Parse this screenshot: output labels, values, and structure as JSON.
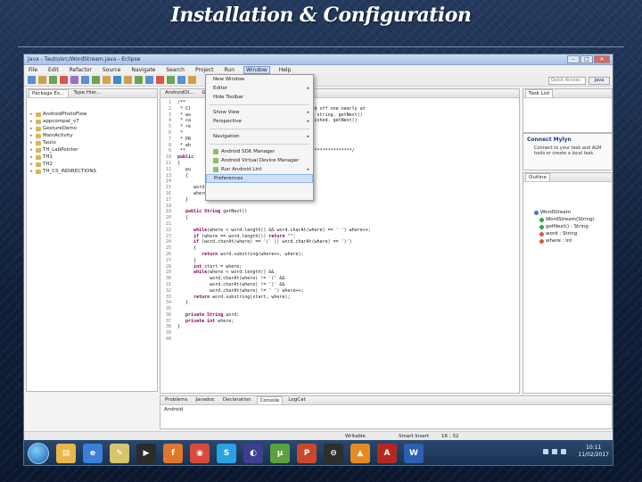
{
  "slide": {
    "title": "Installation & Configuration"
  },
  "window": {
    "title": "Java - Tauto/src/WordStream.java - Eclipse",
    "btn_min": "–",
    "btn_max": "□",
    "btn_close": "✕"
  },
  "menubar": [
    "File",
    "Edit",
    "Refactor",
    "Source",
    "Navigate",
    "Search",
    "Project",
    "Run",
    "Window",
    "Help"
  ],
  "toolbar": {
    "quick_access": "Quick Access",
    "perspective": "Java",
    "button_colors": [
      "#5b8fd0",
      "#c9a24d",
      "#6ca453",
      "#d9574a",
      "#9b6fc7",
      "#5b8fd0",
      "#6ca453",
      "#d9a24d",
      "#3e89c6",
      "#c9a24d",
      "#6ca453",
      "#5b8fd0",
      "#d9574a",
      "#6ca453",
      "#5b8fd0",
      "#c9a24d"
    ]
  },
  "package_explorer": {
    "tabs": [
      "Package Ex...",
      "Type Hier..."
    ],
    "items": [
      "AndroidPhotoFlow",
      "appcompat_v7",
      "GestureDemo",
      "MainActivity",
      "Tauto",
      "TH_LabPointer",
      "TH1",
      "TH2",
      "TH_CS_INDIRECTIONS"
    ]
  },
  "editor": {
    "tabs": [
      "AndroidOl...",
      "GestureAct...",
      "WordStream.java"
    ],
    "lines": [
      {
        "n": "1",
        "t": " /**"
      },
      {
        "n": "2",
        "t": "  * Cl                                           word off one nearly at"
      },
      {
        "n": "3",
        "t": "  * wo                                           the string. getNext()"
      },
      {
        "n": "4",
        "t": "  * ca                                           finished. getNext()"
      },
      {
        "n": "5",
        "t": "  * re"
      },
      {
        "n": "6",
        "t": "  *"
      },
      {
        "n": "7",
        "t": "  * PR"
      },
      {
        "n": "8",
        "t": "  * wh"
      },
      {
        "n": "9",
        "t": "  **                                           *******************/"
      },
      {
        "n": "10",
        "t": " public"
      },
      {
        "n": "11",
        "t": " {"
      },
      {
        "n": "12",
        "t": "    pu"
      },
      {
        "n": "13",
        "t": "    {"
      },
      {
        "n": "14",
        "t": ""
      },
      {
        "n": "15",
        "t": "       word = w;"
      },
      {
        "n": "16",
        "t": "       where = 0;"
      },
      {
        "n": "17",
        "t": "    }"
      },
      {
        "n": "18",
        "t": ""
      },
      {
        "n": "19",
        "t": "    public String getNext()"
      },
      {
        "n": "20",
        "t": "    {"
      },
      {
        "n": "21",
        "t": ""
      },
      {
        "n": "22",
        "t": "       while(where < word.length() && word.charAt(where) == ' ') where++;"
      },
      {
        "n": "23",
        "t": "       if (where == word.length()) return \"\";"
      },
      {
        "n": "24",
        "t": "       if (word.charAt(where) == '(' || word.charAt(where) == ')')"
      },
      {
        "n": "25",
        "t": "       {"
      },
      {
        "n": "26",
        "t": "          return word.substring(where++, where);"
      },
      {
        "n": "27",
        "t": "       }"
      },
      {
        "n": "28",
        "t": "       int start = where;"
      },
      {
        "n": "29",
        "t": "       while(where < word.length() &&"
      },
      {
        "n": "30",
        "t": "             word.charAt(where) != '(' &&"
      },
      {
        "n": "31",
        "t": "             word.charAt(where) != ')' &&"
      },
      {
        "n": "32",
        "t": "             word.charAt(where) != ' ') where++;"
      },
      {
        "n": "33",
        "t": "       return word.substring(start, where);"
      },
      {
        "n": "34",
        "t": "    }"
      },
      {
        "n": "35",
        "t": ""
      },
      {
        "n": "36",
        "t": "    private String word;"
      },
      {
        "n": "37",
        "t": "    private int where;"
      },
      {
        "n": "38",
        "t": " }"
      },
      {
        "n": "39",
        "t": ""
      },
      {
        "n": "40",
        "t": ""
      }
    ]
  },
  "window_menu": [
    {
      "label": "New Window",
      "arrow": ""
    },
    {
      "label": "Editor",
      "arrow": "▸"
    },
    {
      "label": "Hide Toolbar",
      "arrow": ""
    },
    {
      "sep": true
    },
    {
      "label": "Show View",
      "arrow": "▸"
    },
    {
      "label": "Perspective",
      "arrow": "▸"
    },
    {
      "sep": true
    },
    {
      "label": "Navigation",
      "arrow": "▸"
    },
    {
      "sep": true
    },
    {
      "label": "Android SDK Manager",
      "arrow": "",
      "icon": true
    },
    {
      "label": "Android Virtual Device Manager",
      "arrow": "",
      "icon": true
    },
    {
      "label": "Run Android Lint",
      "arrow": "▸",
      "icon": true
    },
    {
      "label": "Preferences",
      "arrow": "",
      "hl": true
    }
  ],
  "task_list": {
    "tab": "Task List"
  },
  "mylyn": {
    "title": "Connect Mylyn",
    "text": "Connect to your task and ALM tools or create a local task."
  },
  "outline": {
    "tab": "Outline",
    "items": [
      "WordStream",
      "WordStream(String)",
      "getNext() : String",
      "word : String",
      "where : int"
    ]
  },
  "console": {
    "tabs": [
      "Problems",
      "Javadoc",
      "Declaration",
      "Console",
      "LogCat"
    ],
    "text": "Android"
  },
  "statusbar": {
    "writable": "Writable",
    "insert": "Smart Insert",
    "position": "16 : 32"
  },
  "taskbar": {
    "apps": [
      {
        "name": "explorer",
        "color": "#e8b64a",
        "glyph": "▤"
      },
      {
        "name": "ie",
        "color": "#3b7fd6",
        "glyph": "e"
      },
      {
        "name": "notes",
        "color": "#d8c46c",
        "glyph": "✎"
      },
      {
        "name": "media",
        "color": "#2b2b2b",
        "glyph": "▶"
      },
      {
        "name": "firefox",
        "color": "#e2762b",
        "glyph": "f"
      },
      {
        "name": "chrome",
        "color": "#d84a3b",
        "glyph": "◉"
      },
      {
        "name": "skype",
        "color": "#2aa3e2",
        "glyph": "S"
      },
      {
        "name": "eclipse",
        "color": "#3c3f8f",
        "glyph": "◐"
      },
      {
        "name": "utorrent",
        "color": "#5aa23b",
        "glyph": "µ"
      },
      {
        "name": "powerpoint",
        "color": "#c94a2b",
        "glyph": "P"
      },
      {
        "name": "app",
        "color": "#2e2e2e",
        "glyph": "⊖"
      },
      {
        "name": "vlc",
        "color": "#e58a1f",
        "glyph": "▲"
      },
      {
        "name": "adobe",
        "color": "#b5281f",
        "glyph": "A"
      },
      {
        "name": "word",
        "color": "#2b5fb3",
        "glyph": "W"
      }
    ],
    "time": "10:11",
    "date": "11/02/2017"
  }
}
